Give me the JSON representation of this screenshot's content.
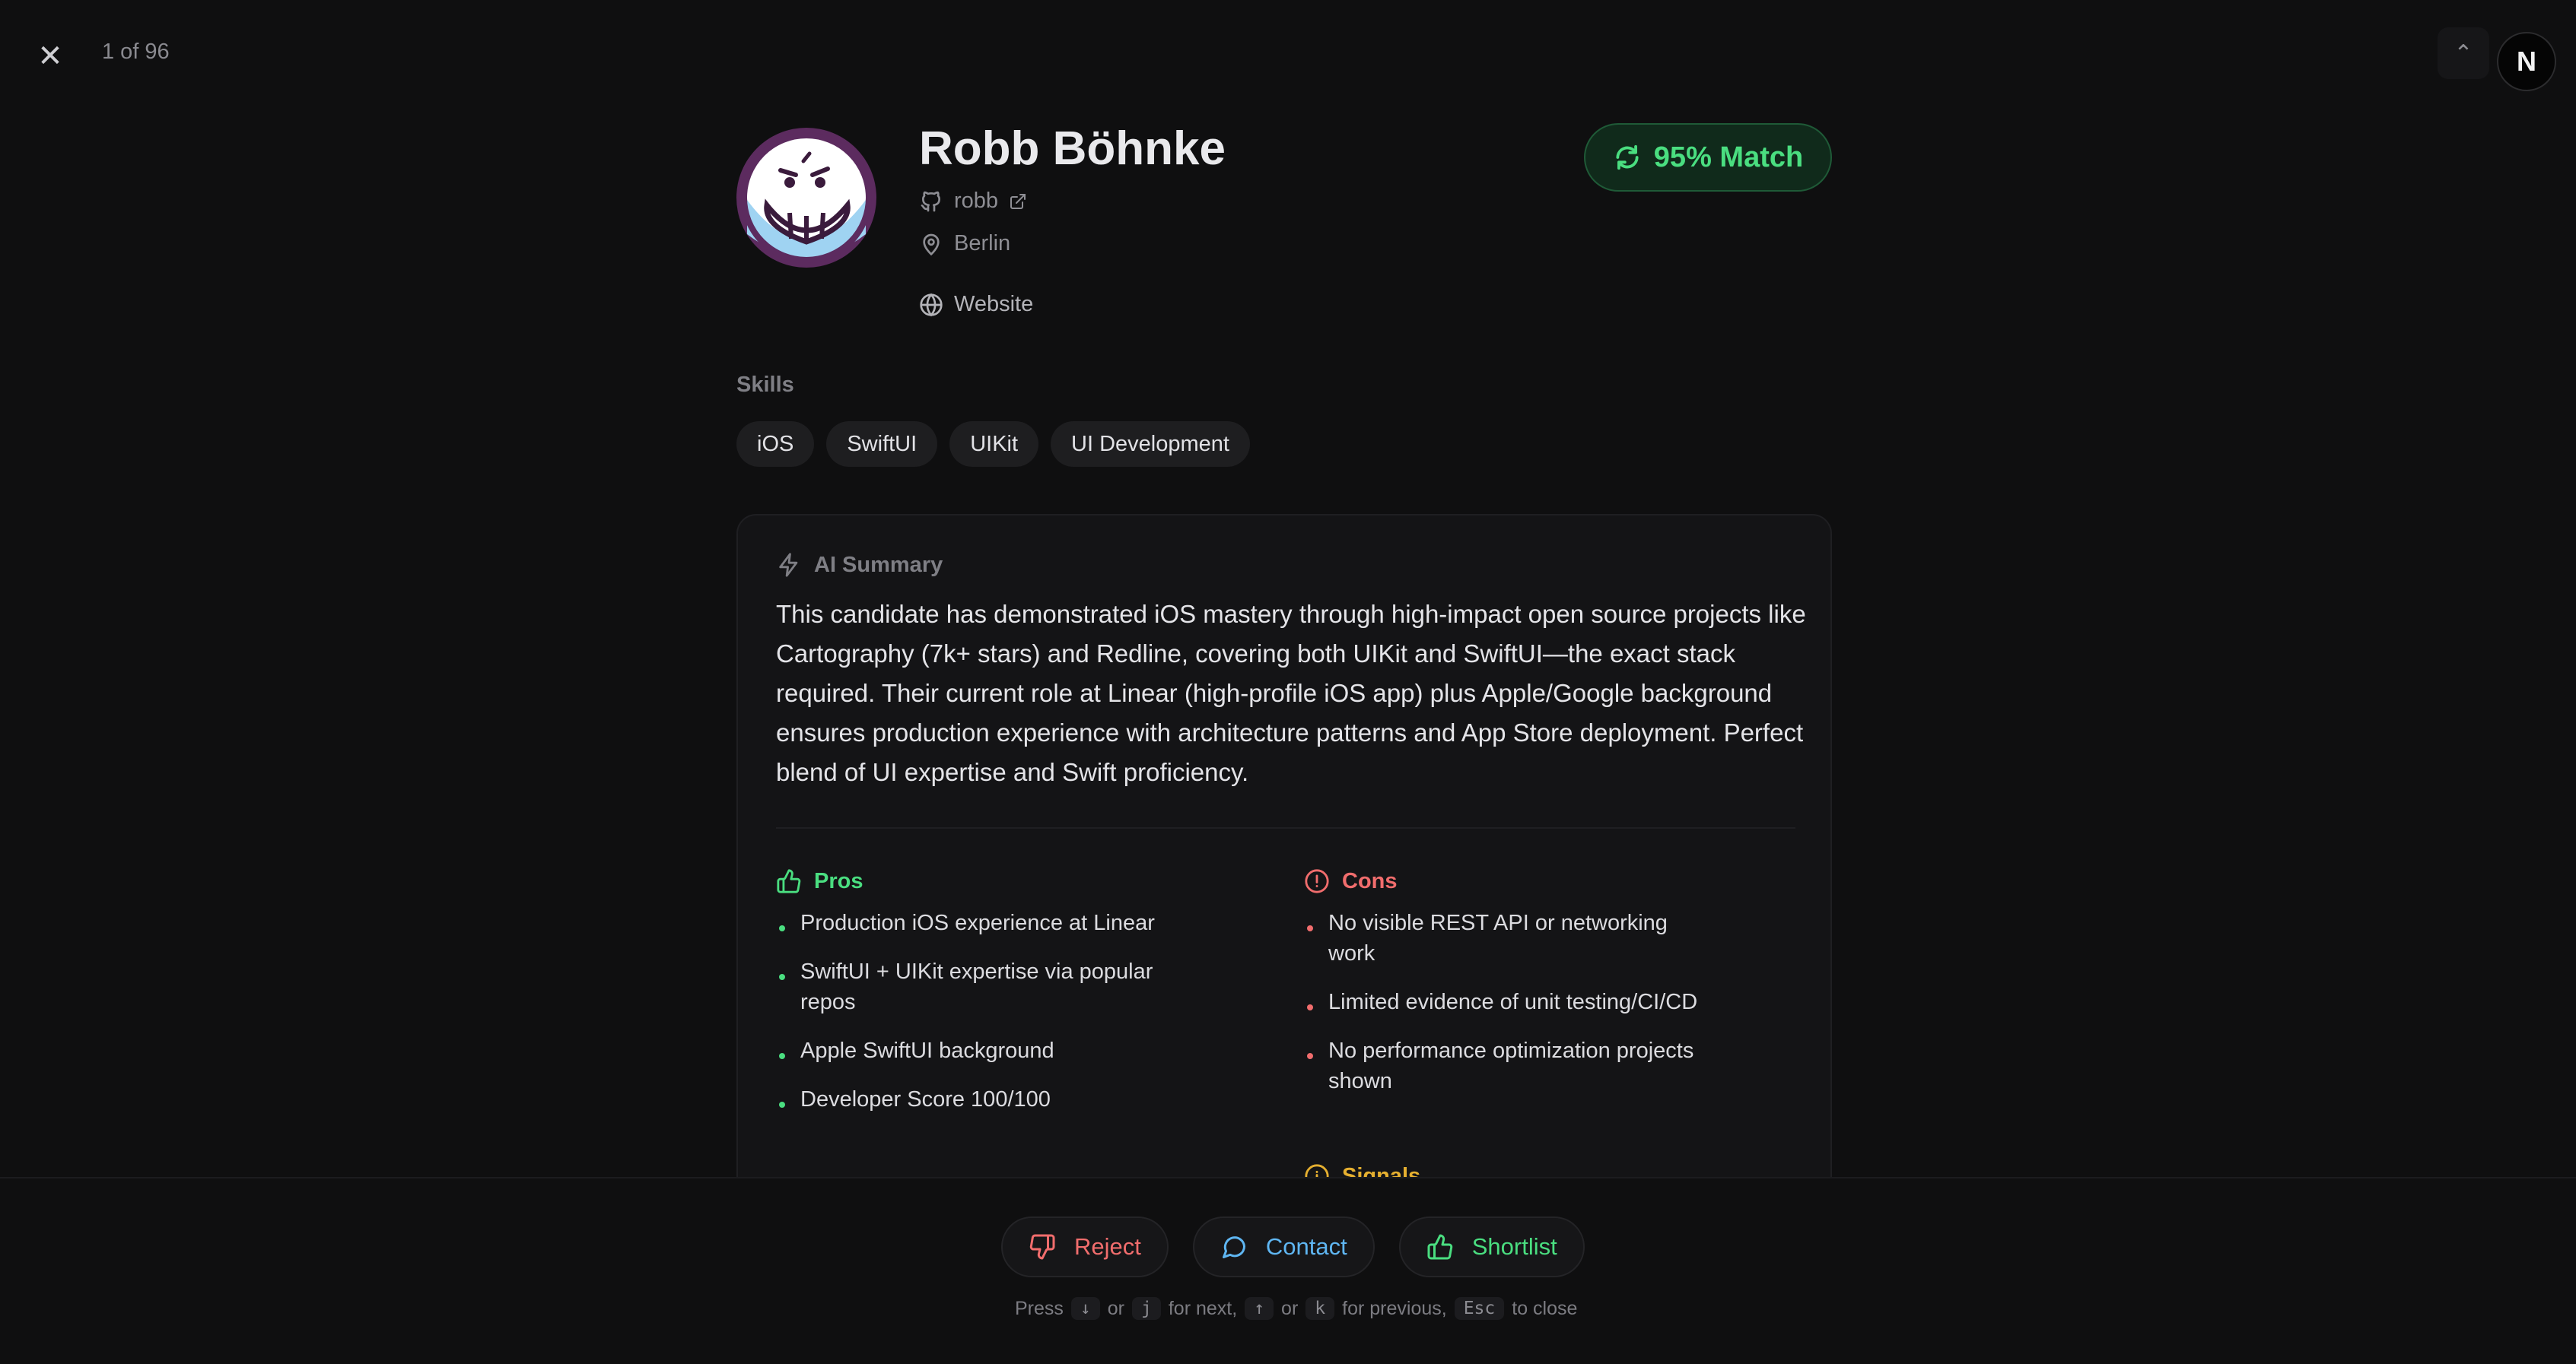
{
  "topbar": {
    "close_icon": "close-icon",
    "counter": "1 of 96",
    "up_icon": "chevron-up-icon",
    "profile_initial": "N"
  },
  "profile": {
    "name": "Robb Böhnke",
    "github_handle": "robb",
    "location": "Berlin",
    "website_label": "Website",
    "match": "95% Match"
  },
  "skills": {
    "label": "Skills",
    "items": [
      "iOS",
      "SwiftUI",
      "UIKit",
      "UI Development"
    ]
  },
  "summary": {
    "label": "AI Summary",
    "text": "This candidate has demonstrated iOS mastery through high-impact open source projects like Cartography (7k+ stars) and Redline, covering both UIKit and SwiftUI—the exact stack required. Their current role at Linear (high-profile iOS app) plus Apple/Google background ensures production experience with architecture patterns and App Store deployment. Perfect blend of UI expertise and Swift proficiency."
  },
  "pros": {
    "label": "Pros",
    "items": [
      "Production iOS experience at Linear",
      "SwiftUI + UIKit expertise via popular repos",
      "Apple SwiftUI background",
      "Developer Score 100/100"
    ]
  },
  "cons": {
    "label": "Cons",
    "items": [
      "No visible REST API or networking work",
      "Limited evidence of unit testing/CI/CD",
      "No performance optimization projects shown"
    ]
  },
  "signals": {
    "label": "Signals"
  },
  "actions": {
    "reject": "Reject",
    "contact": "Contact",
    "shortlist": "Shortlist"
  },
  "hint": {
    "press": "Press",
    "key_down": "↓",
    "or1": "or",
    "key_j": "j",
    "for_next": "for next,",
    "key_up": "↑",
    "or2": "or",
    "key_k": "k",
    "for_previous": "for previous,",
    "key_esc": "Esc",
    "to_close": "to close"
  },
  "colors": {
    "match_green": "#4ade80",
    "cons_red": "#f16d6d",
    "contact_blue": "#5fb6f2",
    "signals_yellow": "#e6b030"
  }
}
